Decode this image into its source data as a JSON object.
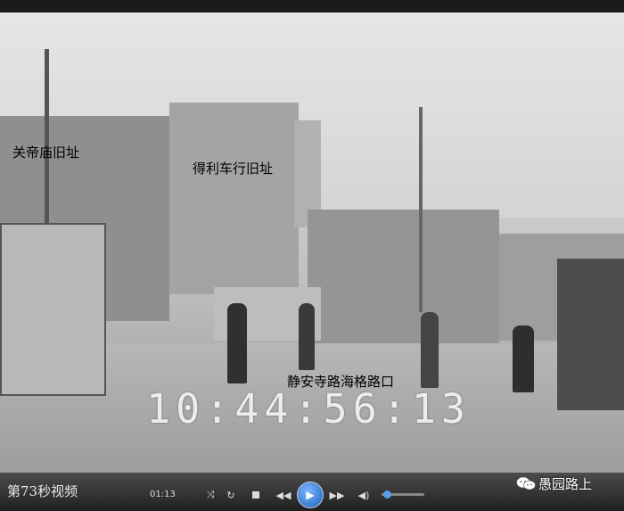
{
  "captions": {
    "temple_site": "关帝庙旧址",
    "shop_site": "得利车行旧址",
    "intersection": "静安寺路海格路口"
  },
  "video": {
    "timestamp": "10:44:56:13"
  },
  "player": {
    "clip_label": "第73秒视频",
    "elapsed": "01:13",
    "volume_fraction": 0.1
  },
  "watermark": {
    "text": "愚园路上",
    "icon": "wechat-icon"
  }
}
